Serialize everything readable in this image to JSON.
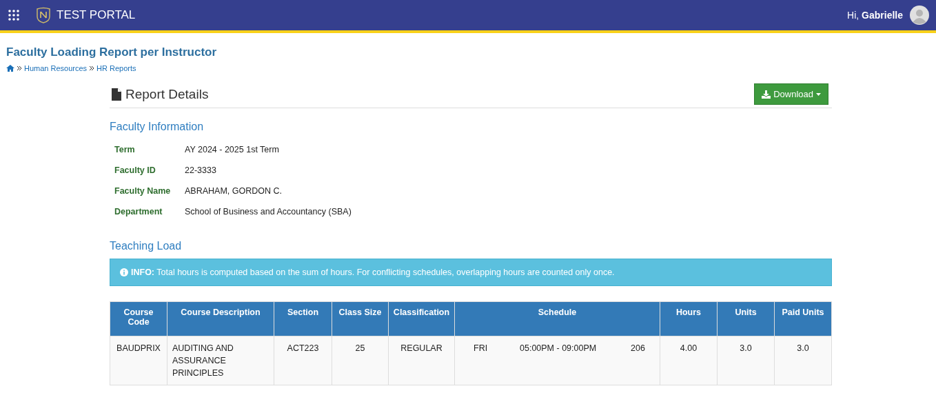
{
  "header": {
    "app_title": "TEST PORTAL",
    "greeting": "Hi,",
    "user_name": "Gabrielle"
  },
  "page": {
    "title": "Faculty Loading Report per Instructor",
    "breadcrumbs": [
      "Human Resources",
      "HR Reports"
    ]
  },
  "report": {
    "title": "Report Details",
    "download_label": "Download"
  },
  "faculty_information": {
    "heading": "Faculty Information",
    "fields": [
      {
        "label": "Term",
        "value": "AY 2024 - 2025 1st Term"
      },
      {
        "label": "Faculty ID",
        "value": "22-3333"
      },
      {
        "label": "Faculty Name",
        "value": "ABRAHAM, GORDON C."
      },
      {
        "label": "Department",
        "value": "School of Business and Accountancy (SBA)"
      }
    ]
  },
  "teaching_load": {
    "heading": "Teaching Load",
    "info": "**INFO:** Total hours is computed based on the sum of hours. For conflicting schedules, overlapping hours are counted only once.",
    "columns": [
      "Course Code",
      "Course Description",
      "Section",
      "Class Size",
      "Classification",
      "Schedule",
      "Hours",
      "Units",
      "Paid Units"
    ],
    "rows": [
      {
        "course_code": "BAUDPRIX",
        "course_description": "AUDITING AND ASSURANCE PRINCIPLES",
        "section": "ACT223",
        "class_size": "25",
        "classification": "REGULAR",
        "schedule": {
          "day": "FRI",
          "time": "05:00PM - 09:00PM",
          "room": "206"
        },
        "hours": "4.00",
        "units": "3.0",
        "paid_units": "3.0"
      }
    ]
  }
}
